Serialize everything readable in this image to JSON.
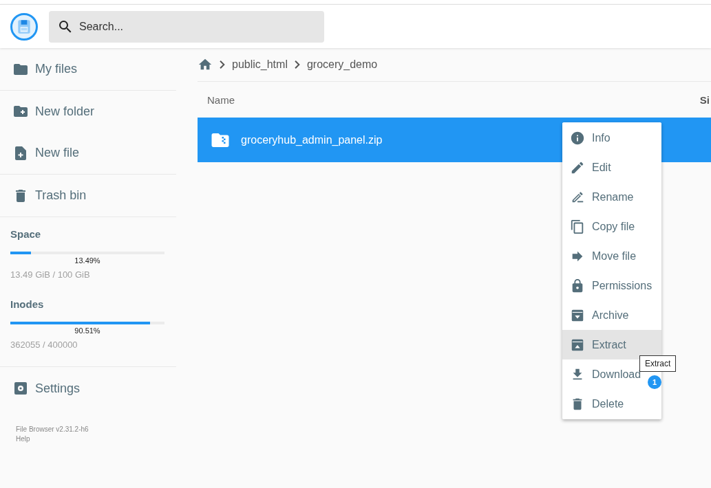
{
  "header": {
    "search": {
      "placeholder": "Search..."
    }
  },
  "sidebar": {
    "items": [
      {
        "label": "My files"
      },
      {
        "label": "New folder"
      },
      {
        "label": "New file"
      },
      {
        "label": "Trash bin"
      }
    ],
    "usage": [
      {
        "title": "Space",
        "level": 0.1349,
        "percent": "13.49%",
        "detail": "13.49 GiB / 100 GiB"
      },
      {
        "title": "Inodes",
        "level": 0.9051,
        "percent": "90.51%",
        "detail": "362055 / 400000"
      }
    ],
    "settings": "Settings",
    "footer": [
      "File Browser v2.31.2-h6",
      "Help"
    ]
  },
  "breadcrumbs": [
    "public_html",
    "grocery_demo"
  ],
  "table": {
    "columns": [
      "Name",
      "Si"
    ],
    "rows": [
      {
        "name": "groceryhub_admin_panel.zip",
        "selected": true
      }
    ]
  },
  "context_menu": {
    "items": [
      {
        "label": "Info",
        "highlighted": false
      },
      {
        "label": "Edit",
        "highlighted": false
      },
      {
        "label": "Rename",
        "highlighted": false
      },
      {
        "label": "Copy file",
        "highlighted": false
      },
      {
        "label": "Move file",
        "highlighted": false
      },
      {
        "label": "Permissions",
        "highlighted": false
      },
      {
        "label": "Archive",
        "highlighted": false
      },
      {
        "label": "Extract",
        "highlighted": true
      },
      {
        "label": "Download",
        "highlighted": false
      },
      {
        "label": "Delete",
        "highlighted": false
      }
    ]
  },
  "tooltip": "Extract",
  "badge": "1"
}
